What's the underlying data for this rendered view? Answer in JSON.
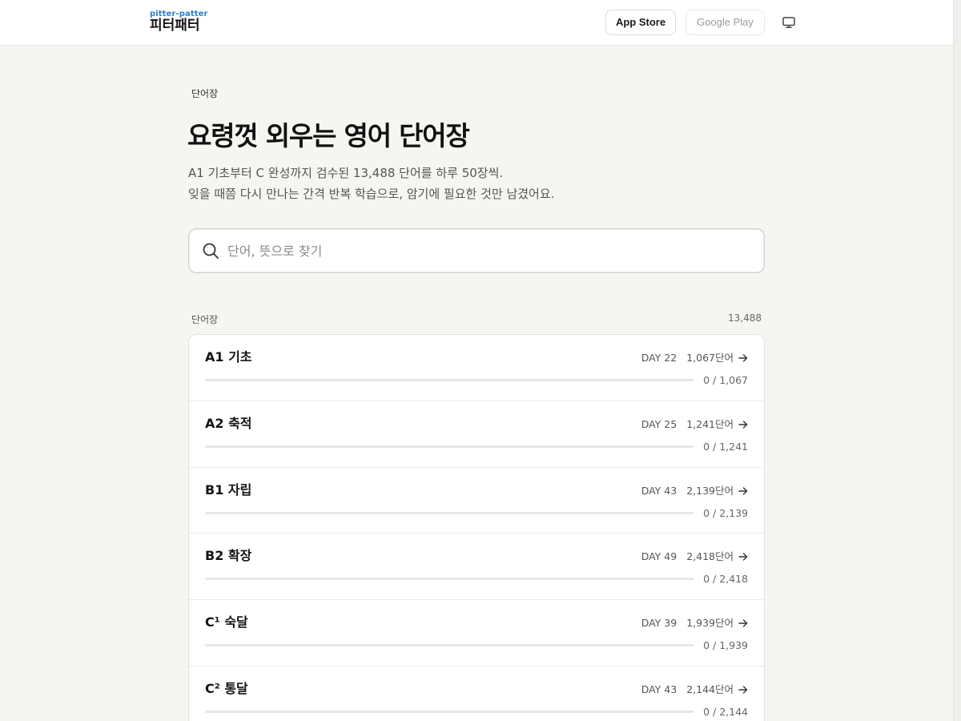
{
  "header": {
    "logo_en": "pitter-patter",
    "logo_ko": "피터패터",
    "app_store_label": "App Store",
    "google_play_label": "Google Play",
    "desktop_icon": "desktop-monitor-icon"
  },
  "breadcrumb": "단어장",
  "title": "요령껏 외우는 영어 단어장",
  "subtitle_line1": "A1 기초부터 C 완성까지 검수된 13,488 단어를 하루 50장씩.",
  "subtitle_line2": "잊을 때쯤 다시 만나는 간격 반복 학습으로, 암기에 필요한 것만 남겼어요.",
  "search": {
    "placeholder": "단어, 뜻으로 찾기",
    "icon": "search-icon"
  },
  "list": {
    "label": "단어장",
    "total": "13,488",
    "arrow_icon": "arrow-right-icon",
    "accent_color": "#2a7fc8",
    "items": [
      {
        "title": "A1 기초",
        "day": "DAY 22",
        "words": "1,067단어",
        "progress": "0 / 1,067",
        "progress_fraction": 0
      },
      {
        "title": "A2 축적",
        "day": "DAY 25",
        "words": "1,241단어",
        "progress": "0 / 1,241",
        "progress_fraction": 0
      },
      {
        "title": "B1 자립",
        "day": "DAY 43",
        "words": "2,139단어",
        "progress": "0 / 2,139",
        "progress_fraction": 0
      },
      {
        "title": "B2 확장",
        "day": "DAY 49",
        "words": "2,418단어",
        "progress": "0 / 2,418",
        "progress_fraction": 0
      },
      {
        "title": "C¹ 숙달",
        "day": "DAY 39",
        "words": "1,939단어",
        "progress": "0 / 1,939",
        "progress_fraction": 0
      },
      {
        "title": "C² 통달",
        "day": "DAY 43",
        "words": "2,144단어",
        "progress": "0 / 2,144",
        "progress_fraction": 0
      }
    ]
  }
}
